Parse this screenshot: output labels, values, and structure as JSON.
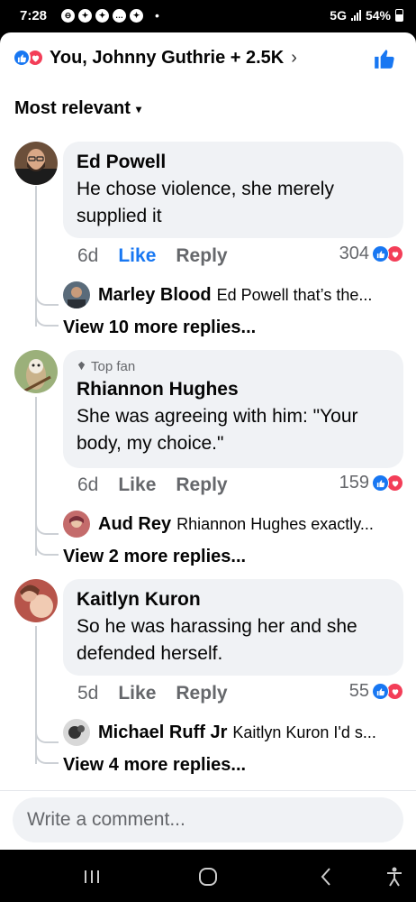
{
  "status": {
    "time": "7:28",
    "dot": "•",
    "network": "5G",
    "battery": "54%"
  },
  "header": {
    "reactions_text": "You, Johnny Guthrie + 2.5K",
    "chevron": "›"
  },
  "sort": {
    "label": "Most relevant"
  },
  "comments": [
    {
      "author": "Ed Powell",
      "text": "He chose violence, she merely supplied it",
      "age": "6d",
      "like_label": "Like",
      "reply_label": "Reply",
      "reaction_count": "304",
      "liked": true,
      "reply_preview": {
        "author": "Marley Blood",
        "snippet": "Ed Powell that’s the..."
      },
      "view_more": "View 10 more replies..."
    },
    {
      "badge": "Top fan",
      "author": "Rhiannon Hughes",
      "text": "She was agreeing with him: \"Your body, my choice.\"",
      "age": "6d",
      "like_label": "Like",
      "reply_label": "Reply",
      "reaction_count": "159",
      "liked": false,
      "reply_preview": {
        "author": "Aud Rey",
        "snippet": "Rhiannon Hughes exactly..."
      },
      "view_more": "View 2 more replies..."
    },
    {
      "author": "Kaitlyn Kuron",
      "text": "So he was harassing her and she defended herself.",
      "age": "5d",
      "like_label": "Like",
      "reply_label": "Reply",
      "reaction_count": "55",
      "liked": false,
      "reply_preview": {
        "author": "Michael Ruff Jr",
        "snippet": "Kaitlyn Kuron I'd s..."
      },
      "view_more": "View 4 more replies..."
    }
  ],
  "composer": {
    "placeholder": "Write a comment..."
  },
  "colors": {
    "facebook_blue": "#1877f2",
    "love_red": "#f33e58",
    "bubble_bg": "#f0f2f5",
    "secondary_text": "#65676b"
  },
  "icons": [
    "like-reaction-icon",
    "love-reaction-icon",
    "thumbs-up-icon",
    "chevron-down-icon",
    "top-fan-icon",
    "recents-icon",
    "home-icon",
    "back-icon",
    "accessibility-icon"
  ]
}
